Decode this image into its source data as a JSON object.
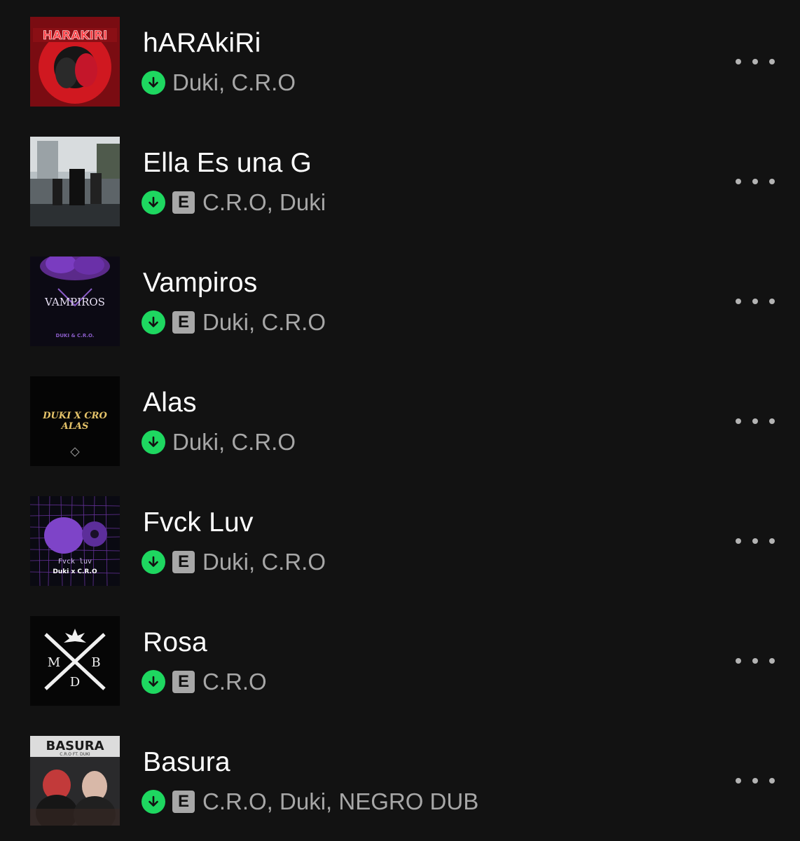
{
  "colors": {
    "background": "#121212",
    "title": "#ffffff",
    "secondary": "#a7a7a7",
    "download_green": "#1ed760"
  },
  "tracks": [
    {
      "title": "hARAkiRi",
      "artists": "Duki, C.R.O",
      "explicit": false,
      "downloaded": true,
      "cover": {
        "text": "HARAKIRI",
        "icon": "red-circle-artwork"
      }
    },
    {
      "title": "Ella Es una G",
      "artists": "C.R.O, Duki",
      "explicit": true,
      "explicit_label": "E",
      "downloaded": true,
      "cover": {
        "icon": "street-photo-artwork"
      }
    },
    {
      "title": "Vampiros",
      "artists": "Duki, C.R.O",
      "explicit": true,
      "explicit_label": "E",
      "downloaded": true,
      "cover": {
        "text": "VAMPIROS",
        "subtext": "DUKI & C.R.O.",
        "icon": "purple-smoke-artwork"
      }
    },
    {
      "title": "Alas",
      "artists": "Duki, C.R.O",
      "explicit": false,
      "downloaded": true,
      "cover": {
        "text": "DUKI X CRO",
        "subtext": "ALAS",
        "icon": "black-gold-text-artwork"
      }
    },
    {
      "title": "Fvck Luv",
      "artists": "Duki, C.R.O",
      "explicit": true,
      "explicit_label": "E",
      "downloaded": true,
      "cover": {
        "text": "Fvck luv",
        "subtext": "Duki x C.R.O",
        "icon": "purple-ghost-grid-artwork"
      }
    },
    {
      "title": "Rosa",
      "artists": "C.R.O",
      "explicit": true,
      "explicit_label": "E",
      "downloaded": true,
      "cover": {
        "icon": "mdb-cross-logo-artwork"
      }
    },
    {
      "title": "Basura",
      "artists": "C.R.O, Duki, NEGRO DUB",
      "explicit": true,
      "explicit_label": "E",
      "downloaded": true,
      "cover": {
        "text": "BASURA",
        "subtext": "C.R.O FT. DUKI",
        "icon": "two-artists-photo-artwork"
      }
    }
  ]
}
